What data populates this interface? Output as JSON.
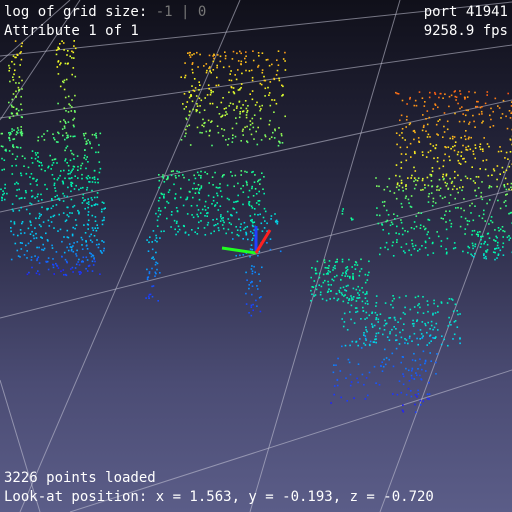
{
  "viewer": {
    "grid_label": "log of grid size:",
    "grid_value_a": "-1",
    "grid_separator": "|",
    "grid_value_b": "0",
    "attribute_text": "Attribute 1 of 1",
    "port_text": "port 41941",
    "fps_text": "9258.9 fps",
    "points_loaded_text": "3226 points loaded",
    "lookat_text": "Look-at position: x = 1.563, y = -0.193, z = -0.720"
  },
  "scene": {
    "objects": [
      "chair",
      "chair",
      "chair",
      "chair",
      "table",
      "chair"
    ],
    "axes_colors": {
      "x": "#ff2020",
      "y": "#20ff20",
      "z": "#2040ff"
    },
    "grid_color": "#c8c8d8",
    "colormap": [
      "#2020ff",
      "#00ccff",
      "#00ffa0",
      "#ffff20",
      "#ff3010"
    ]
  }
}
